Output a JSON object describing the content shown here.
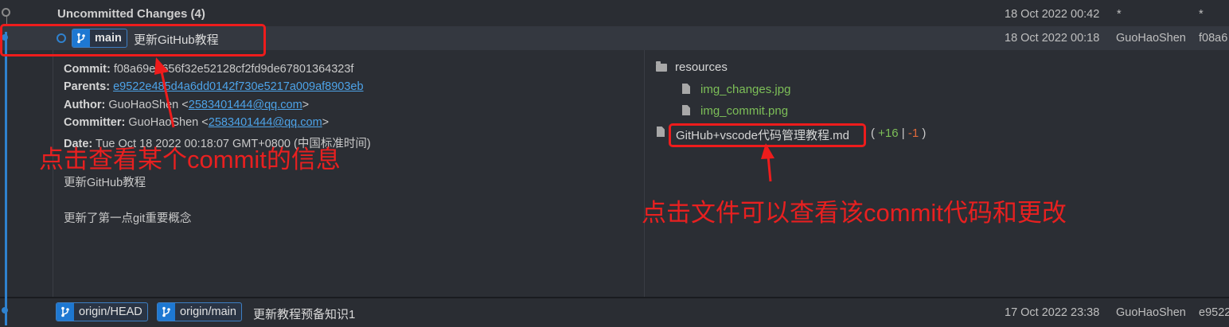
{
  "uncommitted": {
    "title": "Uncommitted Changes (4)",
    "date": "18 Oct 2022 00:42",
    "author": "*",
    "hash": "*"
  },
  "selected_commit": {
    "branch": "main",
    "message": "更新GitHub教程",
    "date": "18 Oct 2022 00:18",
    "author": "GuoHaoShen",
    "hash_short": "f08a6"
  },
  "details": {
    "commit_label": "Commit:",
    "commit_value": "f08a69ee656f32e52128cf2fd9de67801364323f",
    "parents_label": "Parents:",
    "parents_value": "e9522e485d4a6dd0142f730e5217a009af8903eb",
    "author_label": "Author:",
    "author_name": "GuoHaoShen <",
    "author_email": "2583401444@qq.com",
    "author_close": ">",
    "committer_label": "Committer:",
    "committer_name": "GuoHaoShen <",
    "committer_email": "2583401444@qq.com",
    "committer_close": ">",
    "date_label": "Date:",
    "date_value": "Tue Oct 18 2022 00:18:07 GMT+0800 (中国标准时间)",
    "message_title": "更新GitHub教程",
    "message_body": "更新了第一点git重要概念"
  },
  "files": {
    "folder": "resources",
    "folder_files": [
      "img_changes.jpg",
      "img_commit.png"
    ],
    "md_file": "GitHub+vscode代码管理教程.md",
    "stats_open": "( ",
    "additions": "+16",
    "sep": " | ",
    "deletions": "-1",
    "stats_close": " )"
  },
  "origin_commit": {
    "branch1": "origin/HEAD",
    "branch2": "origin/main",
    "message": "更新教程预备知识1",
    "date": "17 Oct 2022 23:38",
    "author": "GuoHaoShen",
    "hash_short": "e9522"
  },
  "annotations": {
    "left": "点击查看某个commit的信息",
    "right": "点击文件可以查看该commit代码和更改"
  },
  "colors": {
    "accent_blue": "#2f82cf",
    "annotation_red": "#ee1c1c",
    "file_green": "#7dbf58",
    "link_blue": "#4da3e8"
  }
}
